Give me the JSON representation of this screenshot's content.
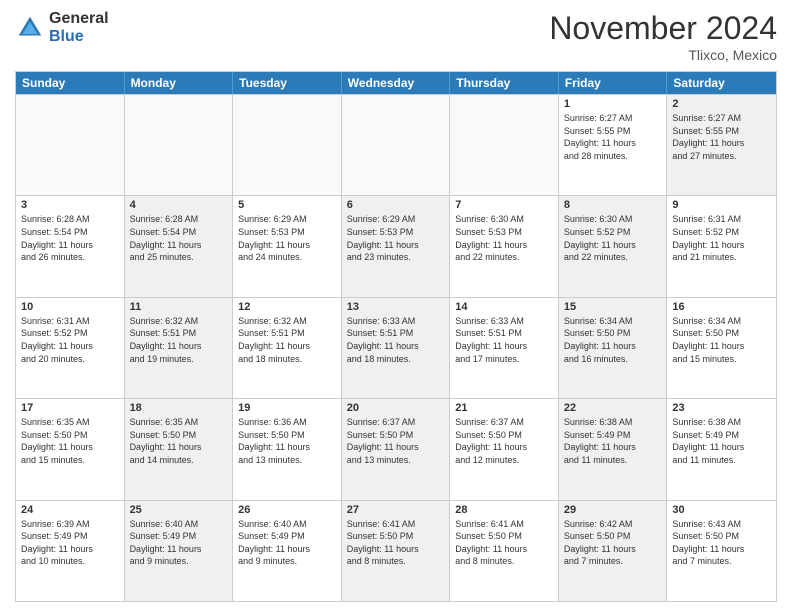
{
  "header": {
    "logo": {
      "general": "General",
      "blue": "Blue"
    },
    "month": "November 2024",
    "location": "Tlixco, Mexico"
  },
  "weekdays": [
    "Sunday",
    "Monday",
    "Tuesday",
    "Wednesday",
    "Thursday",
    "Friday",
    "Saturday"
  ],
  "rows": [
    {
      "cells": [
        {
          "empty": true
        },
        {
          "empty": true
        },
        {
          "empty": true
        },
        {
          "empty": true
        },
        {
          "empty": true
        },
        {
          "day": 1,
          "info": "Sunrise: 6:27 AM\nSunset: 5:55 PM\nDaylight: 11 hours\nand 28 minutes."
        },
        {
          "day": 2,
          "info": "Sunrise: 6:27 AM\nSunset: 5:55 PM\nDaylight: 11 hours\nand 27 minutes.",
          "shaded": true
        }
      ]
    },
    {
      "cells": [
        {
          "day": 3,
          "info": "Sunrise: 6:28 AM\nSunset: 5:54 PM\nDaylight: 11 hours\nand 26 minutes."
        },
        {
          "day": 4,
          "info": "Sunrise: 6:28 AM\nSunset: 5:54 PM\nDaylight: 11 hours\nand 25 minutes.",
          "shaded": true
        },
        {
          "day": 5,
          "info": "Sunrise: 6:29 AM\nSunset: 5:53 PM\nDaylight: 11 hours\nand 24 minutes."
        },
        {
          "day": 6,
          "info": "Sunrise: 6:29 AM\nSunset: 5:53 PM\nDaylight: 11 hours\nand 23 minutes.",
          "shaded": true
        },
        {
          "day": 7,
          "info": "Sunrise: 6:30 AM\nSunset: 5:53 PM\nDaylight: 11 hours\nand 22 minutes."
        },
        {
          "day": 8,
          "info": "Sunrise: 6:30 AM\nSunset: 5:52 PM\nDaylight: 11 hours\nand 22 minutes.",
          "shaded": true
        },
        {
          "day": 9,
          "info": "Sunrise: 6:31 AM\nSunset: 5:52 PM\nDaylight: 11 hours\nand 21 minutes."
        }
      ]
    },
    {
      "cells": [
        {
          "day": 10,
          "info": "Sunrise: 6:31 AM\nSunset: 5:52 PM\nDaylight: 11 hours\nand 20 minutes."
        },
        {
          "day": 11,
          "info": "Sunrise: 6:32 AM\nSunset: 5:51 PM\nDaylight: 11 hours\nand 19 minutes.",
          "shaded": true
        },
        {
          "day": 12,
          "info": "Sunrise: 6:32 AM\nSunset: 5:51 PM\nDaylight: 11 hours\nand 18 minutes."
        },
        {
          "day": 13,
          "info": "Sunrise: 6:33 AM\nSunset: 5:51 PM\nDaylight: 11 hours\nand 18 minutes.",
          "shaded": true
        },
        {
          "day": 14,
          "info": "Sunrise: 6:33 AM\nSunset: 5:51 PM\nDaylight: 11 hours\nand 17 minutes."
        },
        {
          "day": 15,
          "info": "Sunrise: 6:34 AM\nSunset: 5:50 PM\nDaylight: 11 hours\nand 16 minutes.",
          "shaded": true
        },
        {
          "day": 16,
          "info": "Sunrise: 6:34 AM\nSunset: 5:50 PM\nDaylight: 11 hours\nand 15 minutes."
        }
      ]
    },
    {
      "cells": [
        {
          "day": 17,
          "info": "Sunrise: 6:35 AM\nSunset: 5:50 PM\nDaylight: 11 hours\nand 15 minutes."
        },
        {
          "day": 18,
          "info": "Sunrise: 6:35 AM\nSunset: 5:50 PM\nDaylight: 11 hours\nand 14 minutes.",
          "shaded": true
        },
        {
          "day": 19,
          "info": "Sunrise: 6:36 AM\nSunset: 5:50 PM\nDaylight: 11 hours\nand 13 minutes."
        },
        {
          "day": 20,
          "info": "Sunrise: 6:37 AM\nSunset: 5:50 PM\nDaylight: 11 hours\nand 13 minutes.",
          "shaded": true
        },
        {
          "day": 21,
          "info": "Sunrise: 6:37 AM\nSunset: 5:50 PM\nDaylight: 11 hours\nand 12 minutes."
        },
        {
          "day": 22,
          "info": "Sunrise: 6:38 AM\nSunset: 5:49 PM\nDaylight: 11 hours\nand 11 minutes.",
          "shaded": true
        },
        {
          "day": 23,
          "info": "Sunrise: 6:38 AM\nSunset: 5:49 PM\nDaylight: 11 hours\nand 11 minutes."
        }
      ]
    },
    {
      "cells": [
        {
          "day": 24,
          "info": "Sunrise: 6:39 AM\nSunset: 5:49 PM\nDaylight: 11 hours\nand 10 minutes."
        },
        {
          "day": 25,
          "info": "Sunrise: 6:40 AM\nSunset: 5:49 PM\nDaylight: 11 hours\nand 9 minutes.",
          "shaded": true
        },
        {
          "day": 26,
          "info": "Sunrise: 6:40 AM\nSunset: 5:49 PM\nDaylight: 11 hours\nand 9 minutes."
        },
        {
          "day": 27,
          "info": "Sunrise: 6:41 AM\nSunset: 5:50 PM\nDaylight: 11 hours\nand 8 minutes.",
          "shaded": true
        },
        {
          "day": 28,
          "info": "Sunrise: 6:41 AM\nSunset: 5:50 PM\nDaylight: 11 hours\nand 8 minutes."
        },
        {
          "day": 29,
          "info": "Sunrise: 6:42 AM\nSunset: 5:50 PM\nDaylight: 11 hours\nand 7 minutes.",
          "shaded": true
        },
        {
          "day": 30,
          "info": "Sunrise: 6:43 AM\nSunset: 5:50 PM\nDaylight: 11 hours\nand 7 minutes."
        }
      ]
    }
  ]
}
